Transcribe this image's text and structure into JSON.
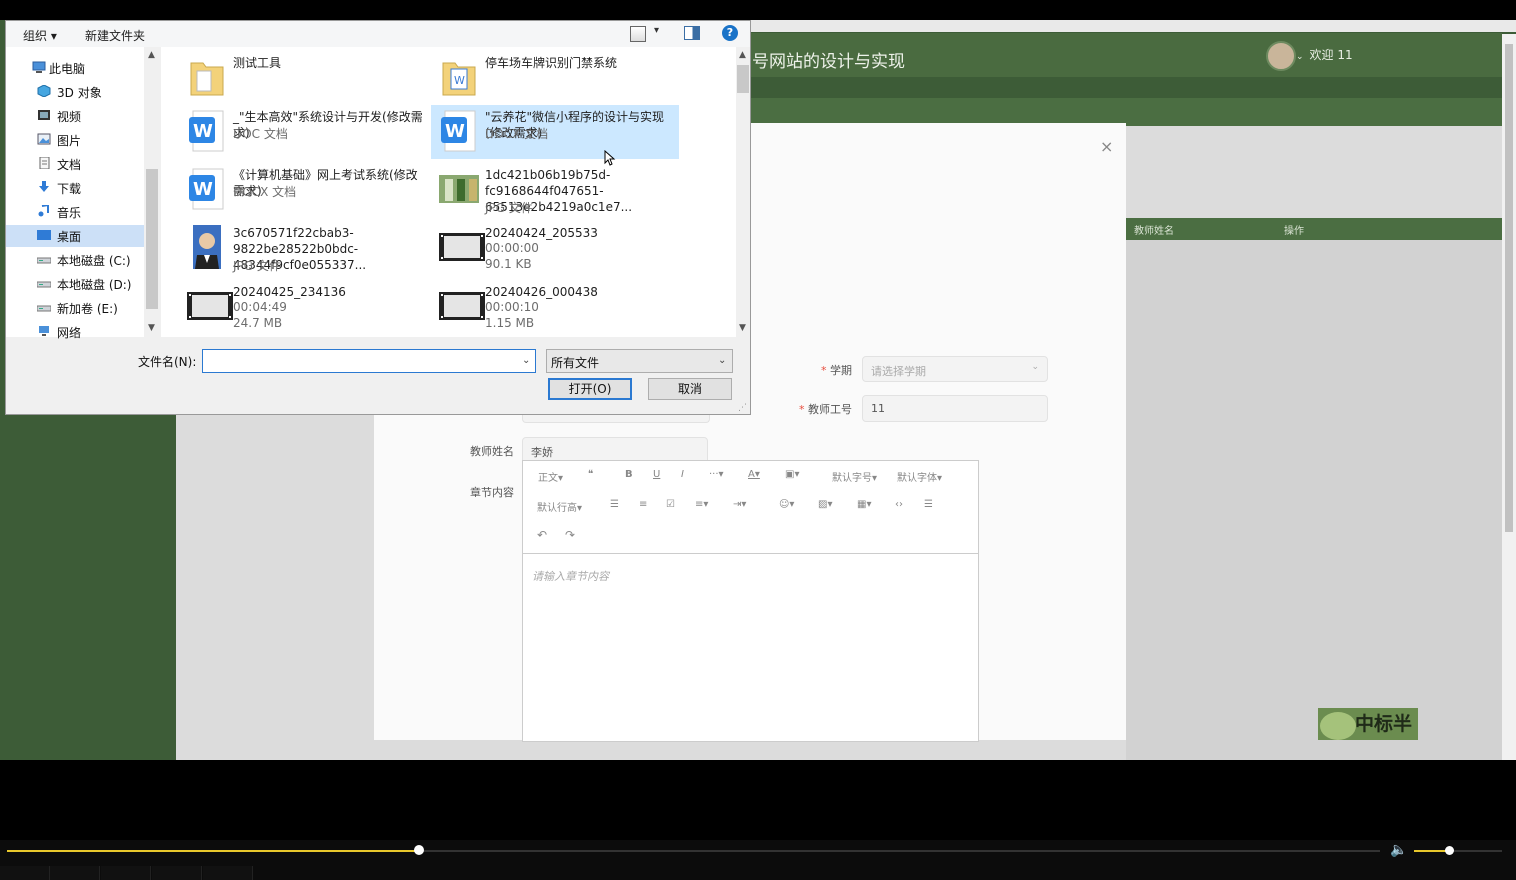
{
  "background_page": {
    "site_title": "号网站的设计与实现",
    "welcome": "欢迎 11",
    "table_columns": [
      "教师姓名",
      "操作"
    ],
    "form": {
      "semester_label": "学期",
      "semester_placeholder": "请选择学期",
      "teacher_id_label": "教师工号",
      "teacher_id_value": "11",
      "teacher_name_label": "教师姓名",
      "teacher_name_value": "李娇",
      "chapter_label": "章节内容",
      "editor_placeholder": "请输入章节内容",
      "editor_toolbar": {
        "paragraph": "正文",
        "font_size": "默认字号",
        "font_family": "默认字体",
        "line_height": "默认行高"
      }
    },
    "close_symbol": "×",
    "stamp_text": "中标半"
  },
  "dialog": {
    "toolbar": {
      "organize": "组织",
      "new_folder": "新建文件夹",
      "help": "?"
    },
    "nav_items": [
      {
        "label": "此电脑",
        "icon": "computer-icon"
      },
      {
        "label": "3D 对象",
        "icon": "3d-objects-icon"
      },
      {
        "label": "视频",
        "icon": "video-icon"
      },
      {
        "label": "图片",
        "icon": "pictures-icon"
      },
      {
        "label": "文档",
        "icon": "documents-icon"
      },
      {
        "label": "下载",
        "icon": "download-icon"
      },
      {
        "label": "音乐",
        "icon": "music-icon"
      },
      {
        "label": "桌面",
        "icon": "desktop-icon",
        "selected": true
      },
      {
        "label": "本地磁盘 (C:)",
        "icon": "drive-icon"
      },
      {
        "label": "本地磁盘 (D:)",
        "icon": "drive-icon"
      },
      {
        "label": "新加卷 (E:)",
        "icon": "drive-icon"
      },
      {
        "label": "网络",
        "icon": "network-icon"
      }
    ],
    "files": [
      {
        "name": "测试工具",
        "lines": [],
        "icon": "folder-icon"
      },
      {
        "name": "停车场车牌识别门禁系统",
        "lines": [],
        "icon": "folder-doc-icon"
      },
      {
        "name": "_\"生本高效\"系统设计与开发(修改需求)",
        "lines": [
          "DOC 文档"
        ],
        "icon": "word-icon"
      },
      {
        "name": "\"云养花\"微信小程序的设计与实现(修改需求)",
        "lines": [
          "DOCX 文档"
        ],
        "icon": "word-icon",
        "selected": true
      },
      {
        "name": "《计算机基础》网上考试系统(修改需求)",
        "lines": [
          "DOCX 文档"
        ],
        "icon": "word-icon"
      },
      {
        "name": "1dc421b06b19b75d-fc9168644f047651-65513e2b4219a0c1e7...",
        "lines": [
          "JPG 文件"
        ],
        "icon": "image-thumbnail-icon"
      },
      {
        "name": "3c670571f22cbab3-9822be28522b0bdc-48344f9cf0e055337...",
        "lines": [
          "JPG 文件"
        ],
        "icon": "portrait-thumbnail-icon"
      },
      {
        "name": "20240424_205533",
        "lines": [
          "00:00:00",
          "90.1 KB"
        ],
        "icon": "video-thumbnail-icon"
      },
      {
        "name": "20240425_234136",
        "lines": [
          "00:04:49",
          "24.7 MB"
        ],
        "icon": "video-thumbnail-icon"
      },
      {
        "name": "20240426_000438",
        "lines": [
          "00:00:10",
          "1.15 MB"
        ],
        "icon": "video-thumbnail-icon"
      }
    ],
    "filename_label": "文件名(N):",
    "filename_value": "",
    "filetype_value": "所有文件",
    "open_button": "打开(O)",
    "cancel_button": "取消"
  },
  "player": {
    "progress": 0.3,
    "volume": 0.4
  },
  "colors": {
    "theme_green": "#4a6b40",
    "dialog_selection": "#cce8ff",
    "progress_accent": "#e8c82c",
    "required_mark": "#e74c3c"
  }
}
